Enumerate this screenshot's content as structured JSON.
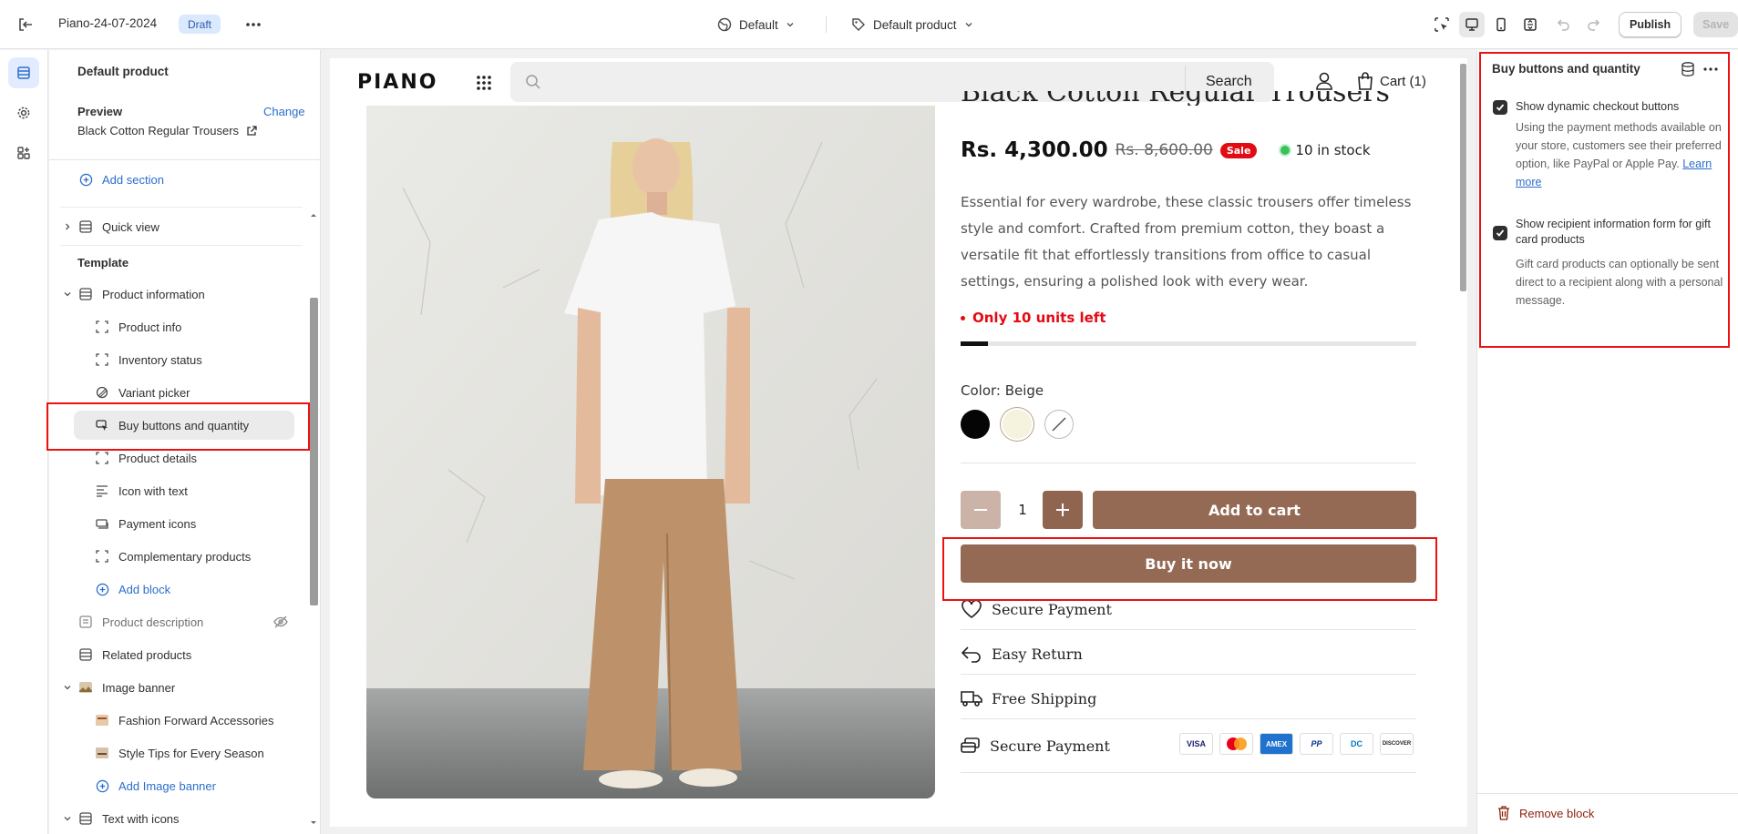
{
  "topbar": {
    "app_title": "Piano-24-07-2024",
    "status_badge": "Draft",
    "theme_select": "Default",
    "template_select": "Default product",
    "publish_label": "Publish",
    "save_label": "Save"
  },
  "sidebar": {
    "title": "Default product",
    "preview_label": "Preview",
    "change_label": "Change",
    "preview_product": "Black Cotton Regular Trousers",
    "add_section": "Add section",
    "quick_view": "Quick view",
    "template_label": "Template",
    "product_information": "Product information",
    "blocks": [
      {
        "label": "Product info",
        "icon": "corners-icon"
      },
      {
        "label": "Inventory status",
        "icon": "corners-icon"
      },
      {
        "label": "Variant picker",
        "icon": "variant-icon"
      },
      {
        "label": "Buy buttons and quantity",
        "icon": "cursor-icon"
      },
      {
        "label": "Product details",
        "icon": "corners-icon"
      },
      {
        "label": "Icon with text",
        "icon": "text-lines-icon"
      },
      {
        "label": "Payment icons",
        "icon": "cash-icon"
      },
      {
        "label": "Complementary products",
        "icon": "corners-icon"
      }
    ],
    "add_block": "Add block",
    "product_description": "Product description",
    "related_products": "Related products",
    "image_banner": "Image banner",
    "banner_items": [
      "Fashion Forward Accessories",
      "Style Tips for Every Season"
    ],
    "add_image_banner": "Add Image banner",
    "text_with_icons": "Text with icons"
  },
  "store": {
    "logo": "PIANO",
    "search_label": "Search",
    "cart_label": "Cart (1)",
    "product_title": "Black Cotton Regular Trousers",
    "price": "Rs. 4,300.00",
    "compare_price": "Rs. 8,600.00",
    "sale_badge": "Sale",
    "stock": "10 in stock",
    "description": "Essential for every wardrobe, these classic trousers offer timeless style and comfort. Crafted from premium cotton, they boast a versatile fit that effortlessly transitions from office to casual settings, ensuring a polished look with every wear.",
    "units_left": "Only 10 units left",
    "units_progress_percent": 6,
    "color_label": "Color: Beige",
    "quantity": "1",
    "add_to_cart": "Add to cart",
    "buy_now": "Buy it now",
    "features": [
      "Secure Payment",
      "Easy Return",
      "Free Shipping",
      "Secure Payment"
    ],
    "payment_methods": [
      "VISA",
      "MC",
      "AMEX",
      "PP",
      "DC",
      "DISCOVER"
    ]
  },
  "right_panel": {
    "title": "Buy buttons and quantity",
    "option1_label": "Show dynamic checkout buttons",
    "option1_help": "Using the payment methods available on your store, customers see their preferred option, like PayPal or Apple Pay.",
    "learn_more": "Learn more",
    "option2_label": "Show recipient information form for gift card products",
    "option2_help": "Gift card products can optionally be sent direct to a recipient along with a personal message.",
    "remove_block": "Remove block"
  },
  "colors": {
    "accent_blue": "#2c6ecb",
    "brand_brown": "#946a55",
    "sale_red": "#e30b13",
    "highlight_red": "#ee1111"
  }
}
